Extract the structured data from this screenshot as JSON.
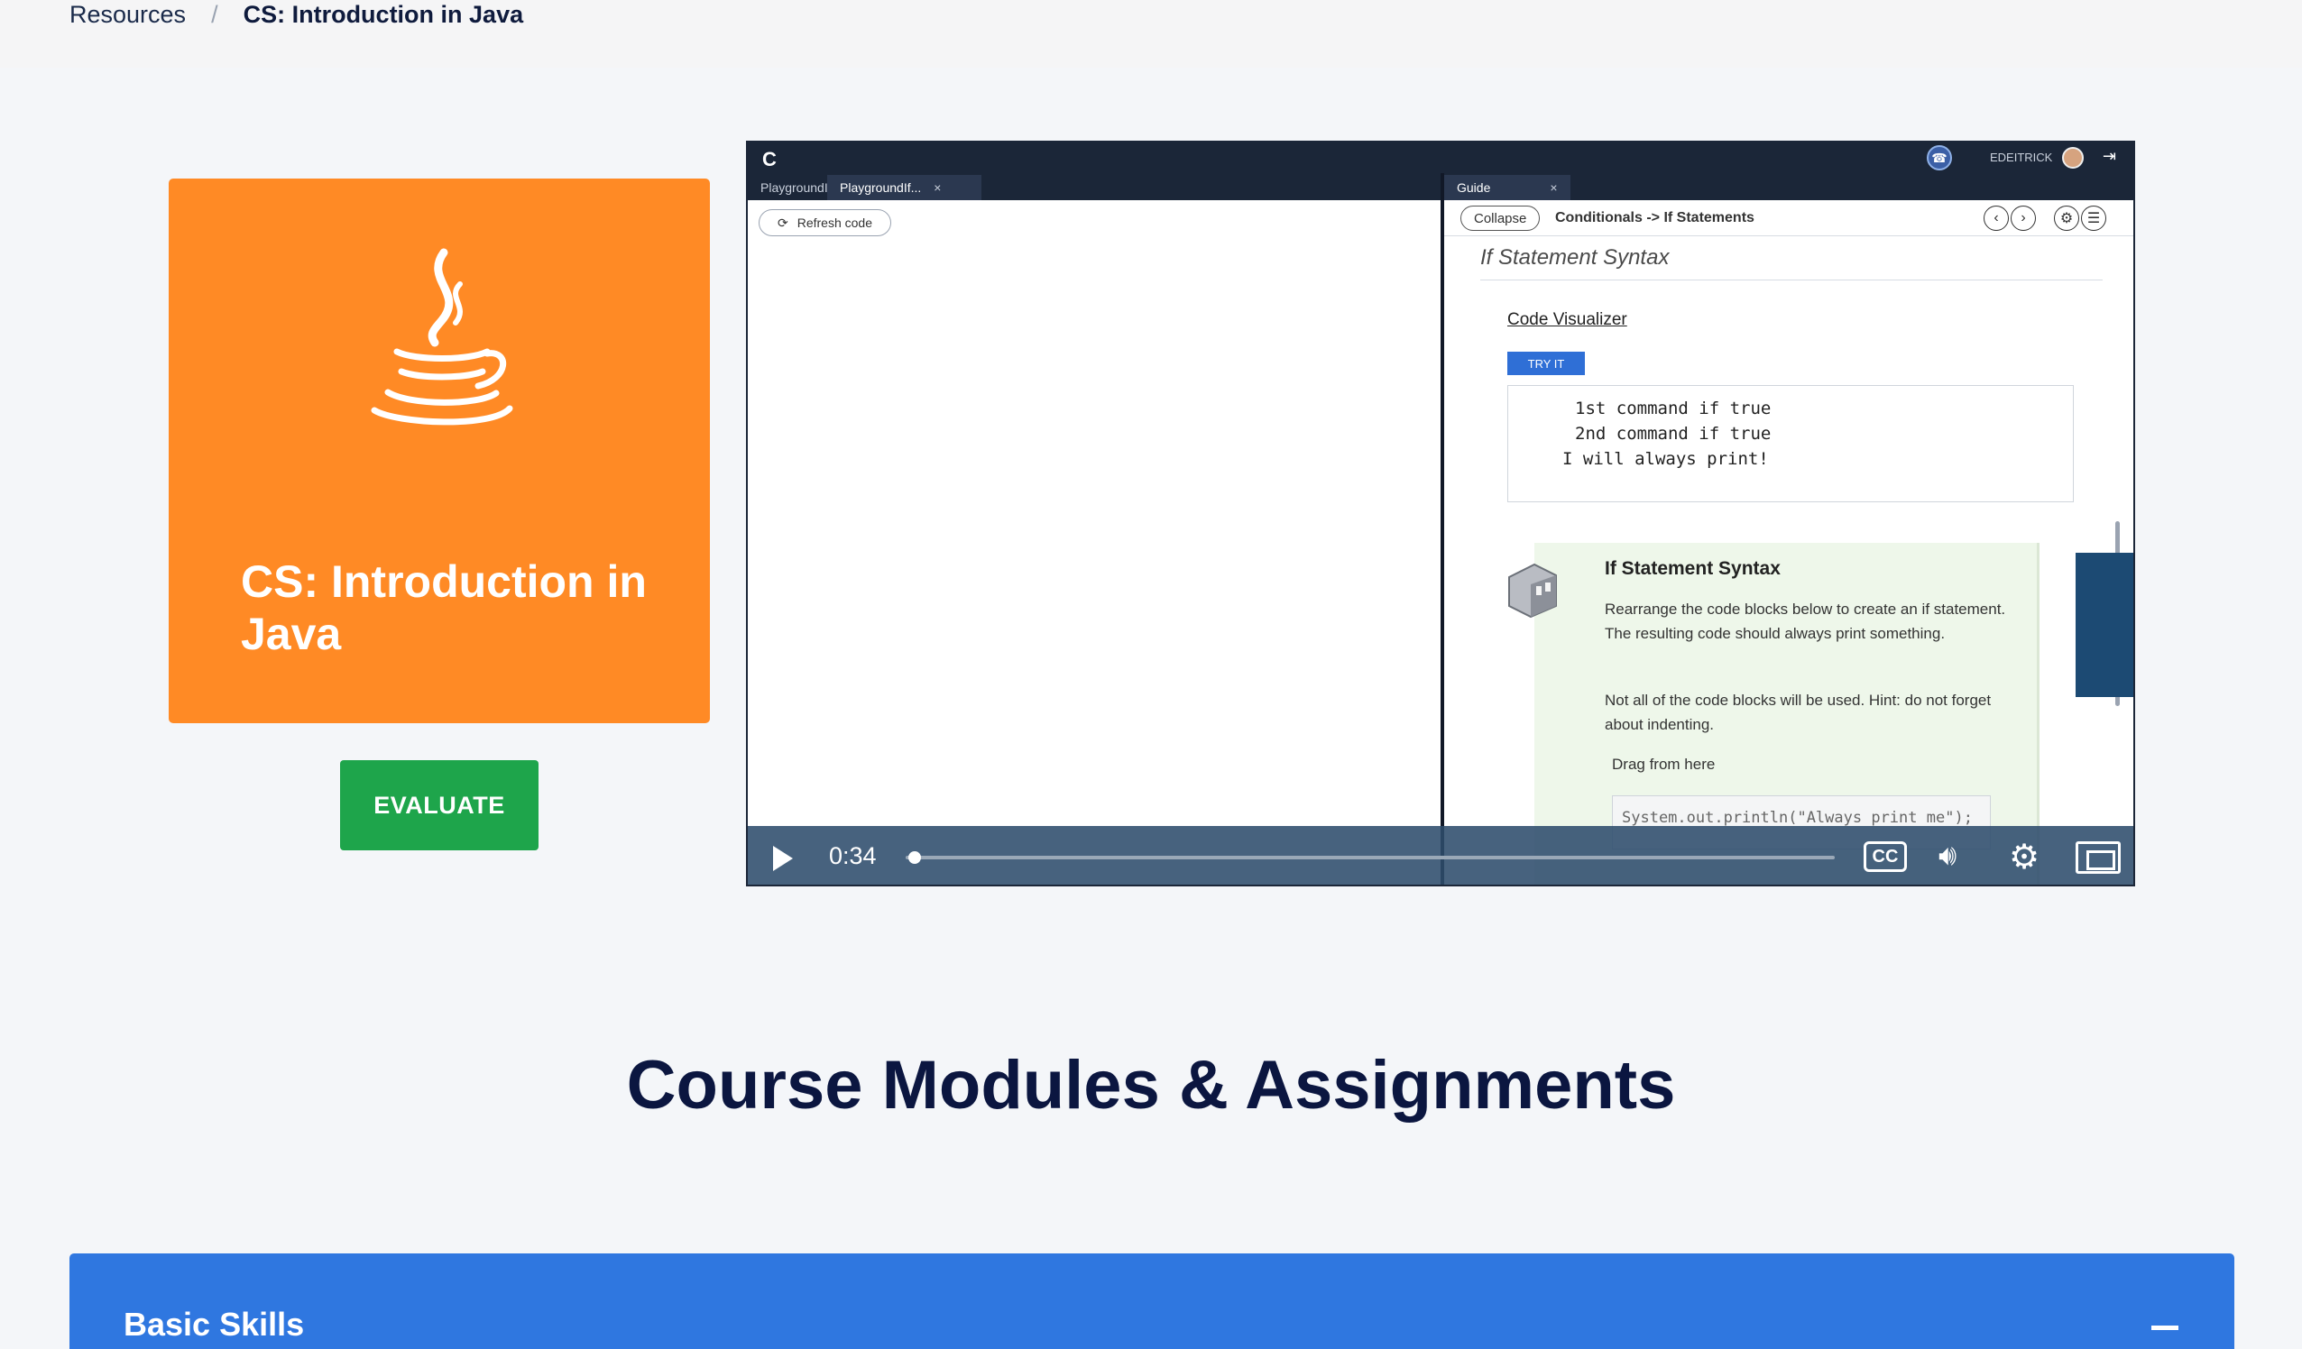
{
  "breadcrumb": {
    "parent": "Resources",
    "separator": "/",
    "current": "CS: Introduction in Java"
  },
  "course": {
    "title": "CS: Introduction in Java",
    "icon": "java-coffee-cup-icon",
    "tile_color": "#ff8a25",
    "evaluate_label": "EVALUATE",
    "evaluate_color": "#1ea54b"
  },
  "video": {
    "app": {
      "username": "EDEITRICK",
      "left_tabs": [
        {
          "label": "PlaygroundIfSy...",
          "close": ""
        },
        {
          "label": "PlaygroundIf...",
          "close": "×"
        }
      ],
      "refresh_label": "Refresh code",
      "right_tab": {
        "label": "Guide",
        "close": "×"
      },
      "collapse_label": "Collapse",
      "guide_path": "Conditionals -> If Statements",
      "section_heading": "If Statement Syntax",
      "code_visualizer_label": "Code Visualizer",
      "try_it_label": "TRY IT",
      "code_lines": [
        "1st command if true",
        "2nd command if true",
        "I will always print!"
      ],
      "hint": {
        "title": "If Statement Syntax",
        "paragraph1": "Rearrange the code blocks below to create an if statement. The resulting code should always print something.",
        "paragraph2": "Not all of the code blocks will be used. Hint: do not forget about indenting.",
        "drag_label": "Drag from here",
        "drag_block": "System.out.println(\"Always print me\");"
      }
    },
    "player": {
      "time": "0:34",
      "progress": 0.01,
      "cc_label": "CC"
    }
  },
  "modules": {
    "heading": "Course Modules & Assignments",
    "accordion_title": "Basic Skills",
    "accordion_color": "#2f77e0"
  }
}
